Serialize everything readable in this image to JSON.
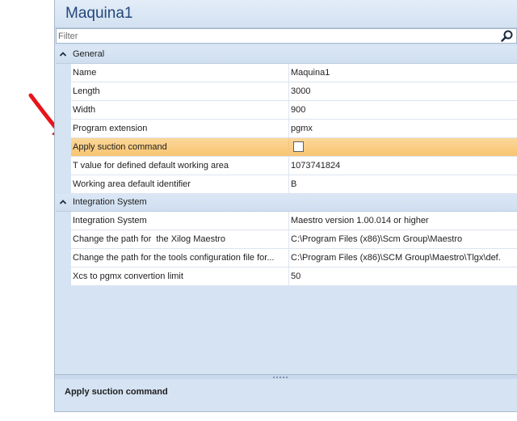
{
  "window": {
    "title": "Maquina1"
  },
  "filter": {
    "placeholder": "Filter"
  },
  "colors": {
    "selected_row": "#f8c471",
    "panel_bg": "#d5e3f3",
    "title_text": "#24477a",
    "annotation_arrow": "#e8141c"
  },
  "categories": [
    {
      "label": "General",
      "expanded": true,
      "rows": [
        {
          "name": "Name",
          "value": "Maquina1"
        },
        {
          "name": "Length",
          "value": "3000"
        },
        {
          "name": "Width",
          "value": "900"
        },
        {
          "name": "Program extension",
          "value": "pgmx"
        },
        {
          "name": "Apply suction command",
          "value": "",
          "type": "checkbox",
          "checked": false,
          "selected": true
        },
        {
          "name": "T value for defined default working area",
          "value": "1073741824"
        },
        {
          "name": "Working area default identifier",
          "value": "B"
        }
      ]
    },
    {
      "label": "Integration System",
      "expanded": true,
      "rows": [
        {
          "name": "Integration System",
          "value": "Maestro version 1.00.014 or higher"
        },
        {
          "name": "Change the path for  the Xilog Maestro",
          "value": "C:\\Program Files (x86)\\Scm Group\\Maestro"
        },
        {
          "name": "Change the path for the tools configuration file for...",
          "value": "C:\\Program Files (x86)\\SCM Group\\Maestro\\Tlgx\\def."
        },
        {
          "name": "Xcs to pgmx convertion limit",
          "value": "50"
        }
      ]
    }
  ],
  "help": {
    "title": "Apply suction command"
  }
}
